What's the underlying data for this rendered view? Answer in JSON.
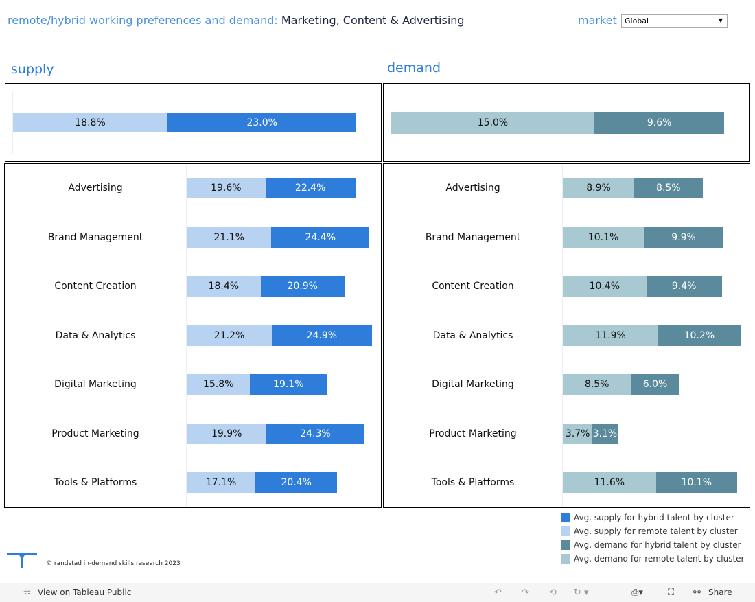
{
  "header": {
    "title_prefix": "remote/hybrid working preferences and demand:",
    "title_cluster": "Marketing, Content & Advertising",
    "market_label": "market",
    "market_value": "Global"
  },
  "sections": {
    "supply": "supply",
    "demand": "demand"
  },
  "colors": {
    "supply_hybrid": "#2e7ddb",
    "supply_remote": "#b8d3f1",
    "demand_hybrid": "#5b8a9c",
    "demand_remote": "#a8c9d1"
  },
  "chart_data": [
    {
      "type": "bar",
      "stacked": true,
      "orientation": "horizontal",
      "title": "supply",
      "summary": {
        "remote": 18.8,
        "hybrid": 23.0
      },
      "categories": [
        "Advertising",
        "Brand Management",
        "Content Creation",
        "Data & Analytics",
        "Digital Marketing",
        "Product Marketing",
        "Tools & Platforms"
      ],
      "series": [
        {
          "name": "Avg. supply for remote talent by cluster",
          "values": [
            19.6,
            21.1,
            18.4,
            21.2,
            15.8,
            19.9,
            17.1
          ]
        },
        {
          "name": "Avg. supply for hybrid talent by cluster",
          "values": [
            22.4,
            24.4,
            20.9,
            24.9,
            19.1,
            24.3,
            20.4
          ]
        }
      ]
    },
    {
      "type": "bar",
      "stacked": true,
      "orientation": "horizontal",
      "title": "demand",
      "summary": {
        "remote": 15.0,
        "hybrid": 9.6
      },
      "categories": [
        "Advertising",
        "Brand Management",
        "Content Creation",
        "Data & Analytics",
        "Digital Marketing",
        "Product Marketing",
        "Tools & Platforms"
      ],
      "series": [
        {
          "name": "Avg. demand for remote talent by cluster",
          "values": [
            8.9,
            10.1,
            10.4,
            11.9,
            8.5,
            3.7,
            11.6
          ]
        },
        {
          "name": "Avg. demand for hybrid talent by cluster",
          "values": [
            8.5,
            9.9,
            9.4,
            10.2,
            6.0,
            3.1,
            10.1
          ]
        }
      ]
    }
  ],
  "legend": [
    "Avg. supply for hybrid talent by cluster",
    "Avg. supply for remote talent by cluster",
    "Avg. demand for hybrid talent by cluster",
    "Avg. demand for remote talent by cluster"
  ],
  "footer": {
    "copyright": "© randstad in-demand skills research 2023",
    "view_link": "View on Tableau Public",
    "share": "Share"
  }
}
